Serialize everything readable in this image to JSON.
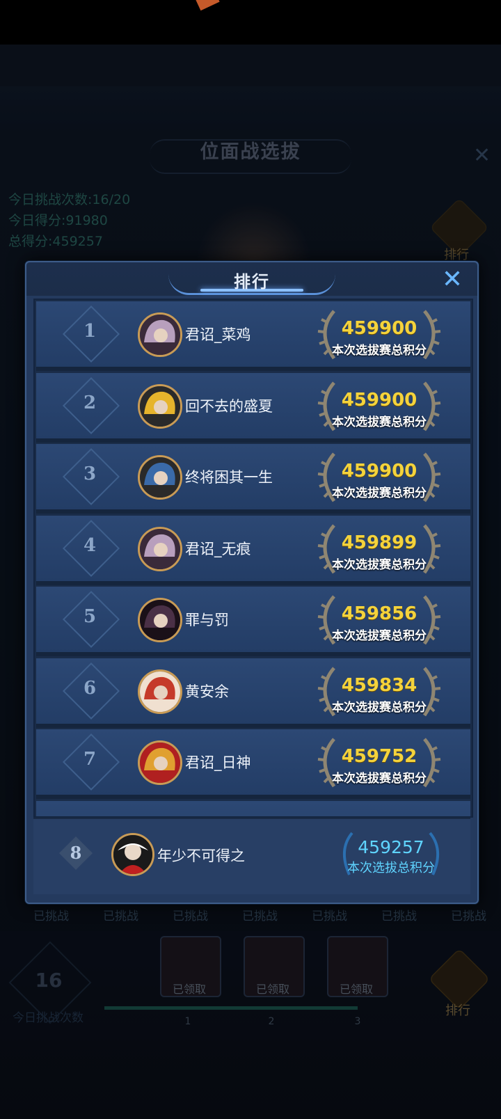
{
  "background": {
    "title": "位面战选拔",
    "close_glyph": "✕",
    "stats": [
      "今日挑战次数:16/20",
      "今日得分:91980",
      "总得分:459257"
    ],
    "rank_button_label": "排行",
    "challenged_label": "已挑战",
    "challenge_count": "16",
    "challenge_count_label": "今日挑战次数",
    "chests": [
      {
        "label": "已领取",
        "milestone": "1"
      },
      {
        "label": "已领取",
        "milestone": "2"
      },
      {
        "label": "已领取",
        "milestone": "3"
      }
    ]
  },
  "modal": {
    "title": "排行",
    "close_glyph": "✕",
    "icons": {
      "close": "close-icon",
      "laurel": "laurel-wreath-icon",
      "avatar": "player-avatar"
    },
    "colors": {
      "score_gold": "#f4d33c",
      "self_score_cyan": "#5fd4ff",
      "panel": "#243a5e"
    },
    "rows": [
      {
        "rank": "1",
        "name": "君诏_菜鸡",
        "score": "459900",
        "score_label": "本次选拔赛总积分",
        "avatar_colors": [
          "#b89fbd",
          "#3a2a3a"
        ]
      },
      {
        "rank": "2",
        "name": "回不去的盛夏",
        "score": "459900",
        "score_label": "本次选拔赛总积分",
        "avatar_colors": [
          "#e6b42c",
          "#2a2a2a"
        ]
      },
      {
        "rank": "3",
        "name": "终将困其一生",
        "score": "459900",
        "score_label": "本次选拔赛总积分",
        "avatar_colors": [
          "#3a6aa8",
          "#2a2a2a"
        ]
      },
      {
        "rank": "4",
        "name": "君诏_无痕",
        "score": "459899",
        "score_label": "本次选拔赛总积分",
        "avatar_colors": [
          "#b89fbd",
          "#3a2a3a"
        ]
      },
      {
        "rank": "5",
        "name": "罪与罚",
        "score": "459856",
        "score_label": "本次选拔赛总积分",
        "avatar_colors": [
          "#4a3046",
          "#1a1018"
        ]
      },
      {
        "rank": "6",
        "name": "黄安余",
        "score": "459834",
        "score_label": "本次选拔赛总积分",
        "avatar_colors": [
          "#c53a2a",
          "#f0e0d0"
        ]
      },
      {
        "rank": "7",
        "name": "君诏_日神",
        "score": "459752",
        "score_label": "本次选拔赛总积分",
        "avatar_colors": [
          "#e0a030",
          "#b02020"
        ]
      }
    ],
    "self": {
      "rank": "8",
      "name": "年少不可得之",
      "score": "459257",
      "score_label": "本次选拔总积分",
      "avatar_colors": [
        "#f2f2f2",
        "#c02020"
      ]
    }
  }
}
